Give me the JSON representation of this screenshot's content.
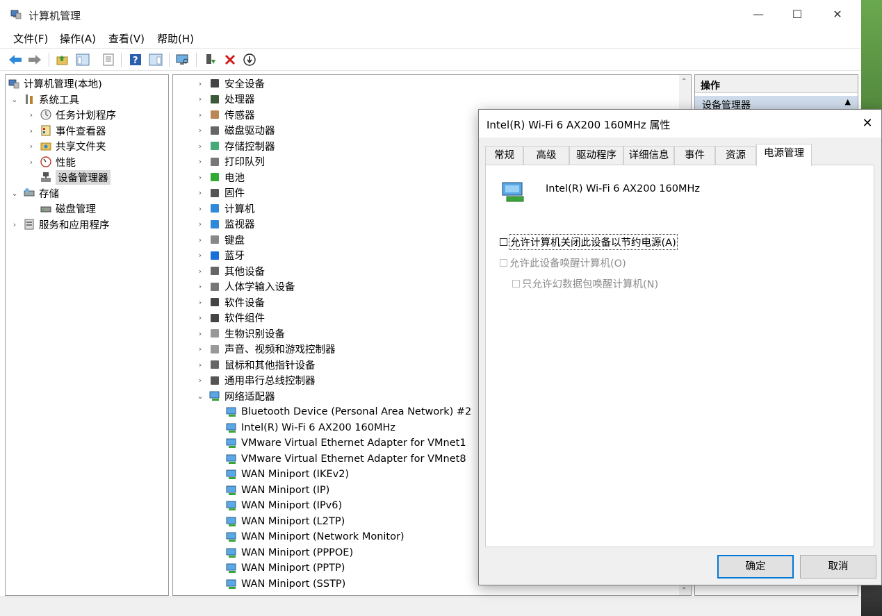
{
  "window": {
    "title": "计算机管理",
    "controls": {
      "minimize": "—",
      "maximize": "☐",
      "close": "✕"
    }
  },
  "menu": [
    "文件(F)",
    "操作(A)",
    "查看(V)",
    "帮助(H)"
  ],
  "toolbar": [
    "back-icon",
    "forward-icon",
    "up-folder-icon",
    "show-hide-tree-icon",
    "properties-icon",
    "help-icon",
    "show-action-pane-icon",
    "scan-hardware-icon",
    "update-driver-icon",
    "uninstall-icon",
    "disable-device-icon"
  ],
  "tree": {
    "root": "计算机管理(本地)",
    "system_tools": "系统工具",
    "task_scheduler": "任务计划程序",
    "event_viewer": "事件查看器",
    "shared_folders": "共享文件夹",
    "performance": "性能",
    "device_manager": "设备管理器",
    "storage": "存储",
    "disk_management": "磁盘管理",
    "services_apps": "服务和应用程序"
  },
  "devices": {
    "categories": [
      "安全设备",
      "处理器",
      "传感器",
      "磁盘驱动器",
      "存储控制器",
      "打印队列",
      "电池",
      "固件",
      "计算机",
      "监视器",
      "键盘",
      "蓝牙",
      "其他设备",
      "人体学输入设备",
      "软件设备",
      "软件组件",
      "生物识别设备",
      "声音、视频和游戏控制器",
      "鼠标和其他指针设备",
      "通用串行总线控制器",
      "网络适配器"
    ],
    "network_adapters": [
      "Bluetooth Device (Personal Area Network) #2",
      "Intel(R) Wi-Fi 6 AX200 160MHz",
      "VMware Virtual Ethernet Adapter for VMnet1",
      "VMware Virtual Ethernet Adapter for VMnet8",
      "WAN Miniport (IKEv2)",
      "WAN Miniport (IP)",
      "WAN Miniport (IPv6)",
      "WAN Miniport (L2TP)",
      "WAN Miniport (Network Monitor)",
      "WAN Miniport (PPPOE)",
      "WAN Miniport (PPTP)",
      "WAN Miniport (SSTP)"
    ]
  },
  "actions": {
    "header": "操作",
    "section": "设备管理器"
  },
  "dialog": {
    "title": "Intel(R) Wi-Fi 6 AX200 160MHz 属性",
    "close": "✕",
    "tabs": [
      "常规",
      "高级",
      "驱动程序",
      "详细信息",
      "事件",
      "资源",
      "电源管理"
    ],
    "active_tab": "电源管理",
    "device_name": "Intel(R) Wi-Fi 6 AX200 160MHz",
    "options": {
      "allow_turn_off": {
        "label": "允许计算机关闭此设备以节约电源(A)",
        "checked": false,
        "enabled": true
      },
      "allow_wake": {
        "label": "允许此设备唤醒计算机(O)",
        "checked": false,
        "enabled": false
      },
      "magic_packet": {
        "label": "只允许幻数据包唤醒计算机(N)",
        "checked": false,
        "enabled": false
      }
    },
    "ok": "确定",
    "cancel": "取消"
  }
}
